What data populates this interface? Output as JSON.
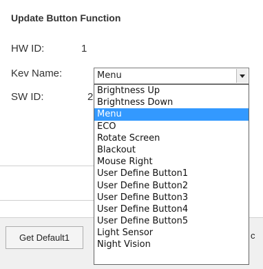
{
  "dialog": {
    "title": "Update Button Function",
    "hw_id_label": "HW ID:",
    "hw_id_value": "1",
    "key_name_label": "Kev Name:",
    "sw_id_label": "SW ID:",
    "sw_id_value_partial": "2"
  },
  "key_combo": {
    "selected": "Menu",
    "options": [
      "Brightness Up",
      "Brightness Down",
      "Menu",
      "ECO",
      "Rotate Screen",
      "Blackout",
      "Mouse Right",
      "User Define Button1",
      "User Define Button2",
      "User Define Button3",
      "User Define Button4",
      "User Define Button5",
      "Light Sensor",
      "Night Vision"
    ],
    "selected_index": 2
  },
  "footer": {
    "get_default_label": "Get Default1",
    "partial_right_char": "c"
  },
  "colors": {
    "highlight": "#3399ff",
    "panel_bg": "#ffffff",
    "bar_bg": "#f0f0f0"
  }
}
